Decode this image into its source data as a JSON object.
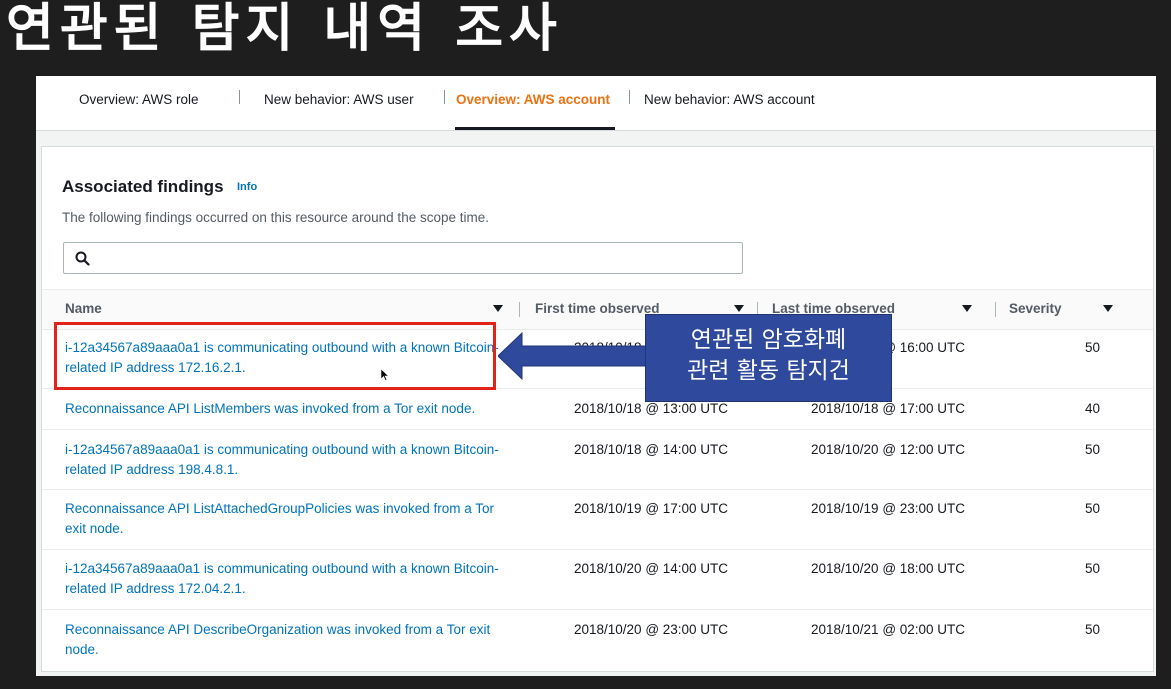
{
  "slide": {
    "title": "연관된 탐지 내역 조사"
  },
  "tabs": [
    {
      "label": "Overview: AWS role",
      "active": false
    },
    {
      "label": "New behavior: AWS user",
      "active": false
    },
    {
      "label": "Overview: AWS account",
      "active": true
    },
    {
      "label": "New behavior: AWS account",
      "active": false
    }
  ],
  "panel": {
    "title": "Associated findings",
    "info": "Info",
    "description": "The following findings occurred on this resource around the scope time.",
    "search_value": ""
  },
  "table": {
    "columns": [
      "Name",
      "First time observed",
      "Last time observed",
      "Severity"
    ],
    "rows": [
      {
        "name": "i-12a34567a89aaa0a1 is communicating outbound with a known Bitcoin-related IP address 172.16.2.1.",
        "first": "2018/10/18 @ 13:00 UTC",
        "last": "2018/10/18 @ 16:00 UTC",
        "severity": "50"
      },
      {
        "name": "Reconnaissance API ListMembers was invoked from a Tor exit node.",
        "first": "2018/10/18 @ 13:00 UTC",
        "last": "2018/10/18 @ 17:00 UTC",
        "severity": "40"
      },
      {
        "name": "i-12a34567a89aaa0a1 is communicating outbound with a known Bitcoin-related IP address 198.4.8.1.",
        "first": "2018/10/18 @ 14:00 UTC",
        "last": "2018/10/20 @ 12:00 UTC",
        "severity": "50"
      },
      {
        "name": "Reconnaissance API ListAttachedGroupPolicies was invoked from a Tor exit node.",
        "first": "2018/10/19 @ 17:00 UTC",
        "last": "2018/10/19 @ 23:00 UTC",
        "severity": "50"
      },
      {
        "name": "i-12a34567a89aaa0a1 is communicating outbound with a known Bitcoin-related IP address 172.04.2.1.",
        "first": "2018/10/20 @ 14:00 UTC",
        "last": "2018/10/20 @ 18:00 UTC",
        "severity": "50"
      },
      {
        "name": "Reconnaissance API DescribeOrganization was invoked from a Tor exit node.",
        "first": "2018/10/20 @ 23:00 UTC",
        "last": "2018/10/21 @ 02:00 UTC",
        "severity": "50"
      }
    ]
  },
  "annotation": {
    "callout_line1": "연관된 암호화폐",
    "callout_line2": "관련 활동 탐지건"
  },
  "colors": {
    "active_tab": "#ec7211",
    "link": "#0073bb",
    "highlight": "#e2231a",
    "callout": "#2f4a9c"
  }
}
